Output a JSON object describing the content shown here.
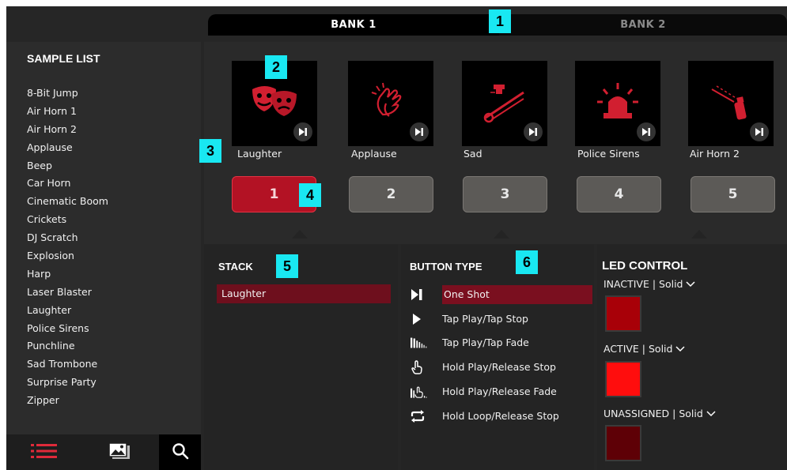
{
  "tabs": [
    {
      "label": "BANK 1",
      "active": true
    },
    {
      "label": "BANK 2",
      "active": false
    }
  ],
  "sidebar": {
    "title": "SAMPLE LIST",
    "samples": [
      "8-Bit Jump",
      "Air Horn 1",
      "Air Horn 2",
      "Applause",
      "Beep",
      "Car Horn",
      "Cinematic Boom",
      "Crickets",
      "DJ Scratch",
      "Explosion",
      "Harp",
      "Laser Blaster",
      "Laughter",
      "Police Sirens",
      "Punchline",
      "Sad Trombone",
      "Surprise Party",
      "Zipper"
    ],
    "bottom_icons": [
      "list-icon",
      "media-icon",
      "search-icon"
    ]
  },
  "pads": [
    {
      "label": "Laughter",
      "number": "1",
      "icon": "theater-masks-icon",
      "active": true
    },
    {
      "label": "Applause",
      "number": "2",
      "icon": "clapping-hands-icon",
      "active": false
    },
    {
      "label": "Sad",
      "number": "3",
      "icon": "trombone-icon",
      "active": false
    },
    {
      "label": "Police Sirens",
      "number": "4",
      "icon": "siren-icon",
      "active": false
    },
    {
      "label": "Air Horn 2",
      "number": "5",
      "icon": "air-horn-icon",
      "active": false
    }
  ],
  "stack": {
    "title": "STACK",
    "items": [
      "Laughter"
    ]
  },
  "button_type": {
    "title": "BUTTON TYPE",
    "selected": "One Shot",
    "items": [
      {
        "label": "One Shot",
        "icon": "one-shot-icon"
      },
      {
        "label": "Tap Play/Tap Stop",
        "icon": "play-icon"
      },
      {
        "label": "Tap Play/Tap Fade",
        "icon": "fade-bars-icon"
      },
      {
        "label": "Hold Play/Release Stop",
        "icon": "hand-press-icon"
      },
      {
        "label": "Hold Play/Release Fade",
        "icon": "hand-fade-icon"
      },
      {
        "label": "Hold Loop/Release Stop",
        "icon": "loop-icon"
      }
    ]
  },
  "led_control": {
    "title": "LED CONTROL",
    "states": [
      {
        "label": "INACTIVE | Solid",
        "color": "#a80008"
      },
      {
        "label": "ACTIVE | Solid",
        "color": "#ff0d0d"
      },
      {
        "label": "UNASSIGNED | Solid",
        "color": "#5e0006"
      }
    ]
  },
  "callouts": [
    "1",
    "2",
    "3",
    "4",
    "5",
    "6"
  ],
  "colors": {
    "accent": "#b31224",
    "selected_row": "#7a0f1f",
    "callout": "#19e8f2"
  }
}
